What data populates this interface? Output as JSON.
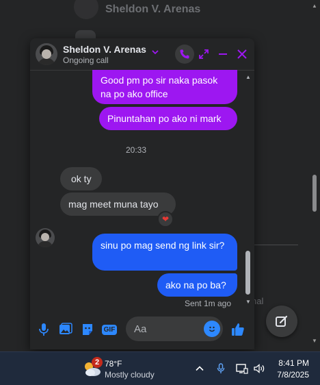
{
  "background": {
    "contact_name": "Sheldon V. Arenas",
    "faded_text": "nal"
  },
  "chat": {
    "header": {
      "name": "Sheldon V. Arenas",
      "status": "Ongoing call"
    },
    "messages": {
      "out1": "Good pm po sir naka pasok na po ako office",
      "out2": "Pinuntahan po ako ni mark",
      "time_sep": "20:33",
      "in1": "ok ty",
      "in2": "mag meet muna tayo",
      "reaction": "❤",
      "out3": "sinu po mag send ng link sir?",
      "out4": "ako na po ba?",
      "sent_status": "Sent 1m ago"
    },
    "composer": {
      "placeholder": "Aa",
      "gif_label": "GIF"
    },
    "colors": {
      "accent": "#9d17f1",
      "outgoing_blue": "#1f5cf5"
    }
  },
  "taskbar": {
    "weather_badge": "2",
    "temperature": "78°F",
    "condition": "Mostly cloudy",
    "time": "8:41 PM",
    "date": "7/8/2025"
  }
}
